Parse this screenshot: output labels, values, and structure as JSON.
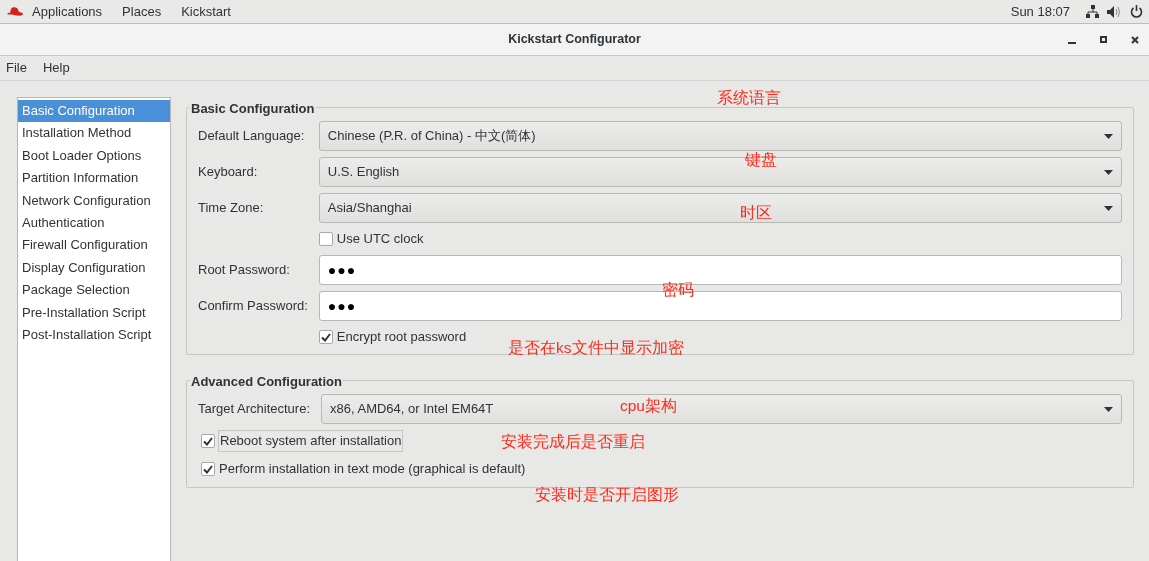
{
  "top_bar": {
    "menus": [
      "Applications",
      "Places",
      "Kickstart"
    ],
    "clock": "Sun 18:07"
  },
  "window": {
    "title": "Kickstart Configurator"
  },
  "menu_bar": [
    "File",
    "Help"
  ],
  "sidebar": {
    "items": [
      {
        "label": "Basic Configuration",
        "selected": true
      },
      {
        "label": "Installation Method",
        "selected": false
      },
      {
        "label": "Boot Loader Options",
        "selected": false
      },
      {
        "label": "Partition Information",
        "selected": false
      },
      {
        "label": "Network Configuration",
        "selected": false
      },
      {
        "label": "Authentication",
        "selected": false
      },
      {
        "label": "Firewall Configuration",
        "selected": false
      },
      {
        "label": "Display Configuration",
        "selected": false
      },
      {
        "label": "Package Selection",
        "selected": false
      },
      {
        "label": "Pre-Installation Script",
        "selected": false
      },
      {
        "label": "Post-Installation Script",
        "selected": false
      }
    ]
  },
  "sections": [
    {
      "title": "Basic Configuration",
      "rows": [
        {
          "kind": "combo",
          "label": "Default Language:",
          "value": "Chinese (P.R. of China) - 中文(简体)"
        },
        {
          "kind": "combo",
          "label": "Keyboard:",
          "value": "U.S. English"
        },
        {
          "kind": "combo",
          "label": "Time Zone:",
          "value": "Asia/Shanghai"
        },
        {
          "kind": "checkbox",
          "label": "Use UTC clock",
          "checked": false,
          "focused": false
        },
        {
          "kind": "password",
          "label": "Root Password:",
          "value": "●●●"
        },
        {
          "kind": "password",
          "label": "Confirm Password:",
          "value": "●●●"
        },
        {
          "kind": "checkbox",
          "label": "Encrypt root password",
          "checked": true,
          "focused": false
        }
      ]
    },
    {
      "title": "Advanced Configuration",
      "rows": [
        {
          "kind": "combo",
          "label": "Target Architecture:",
          "value": "x86, AMD64, or Intel EM64T"
        },
        {
          "kind": "checkbox",
          "label": "Reboot system after installation",
          "checked": true,
          "focused": true
        },
        {
          "kind": "checkbox",
          "label": "Perform installation in text mode (graphical is default)",
          "checked": true,
          "focused": false
        }
      ]
    }
  ],
  "annotations": [
    "系统语言",
    "键盘",
    "时区",
    "密码",
    "是否在ks文件中显示加密",
    "cpu架构",
    "安装完成后是否重启",
    "安装时是否开启图形"
  ]
}
